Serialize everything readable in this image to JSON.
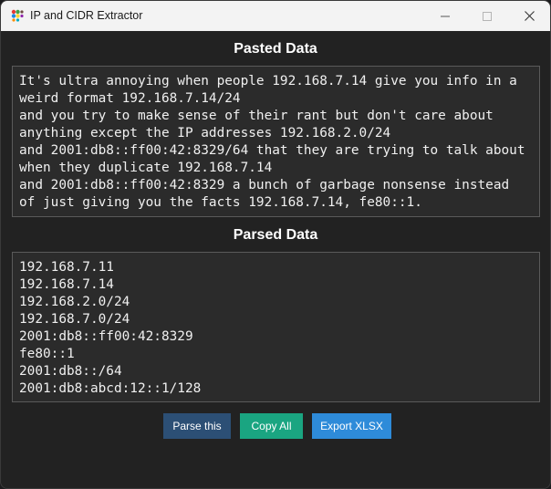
{
  "window": {
    "title": "IP and CIDR Extractor"
  },
  "pasted": {
    "title": "Pasted Data",
    "text": "It's ultra annoying when people 192.168.7.14 give you info in a weird format 192.168.7.14/24\nand you try to make sense of their rant but don't care about anything except the IP addresses 192.168.2.0/24\nand 2001:db8::ff00:42:8329/64 that they are trying to talk about when they duplicate 192.168.7.14\nand 2001:db8::ff00:42:8329 a bunch of garbage nonsense instead of just giving you the facts 192.168.7.14, fe80::1."
  },
  "parsed": {
    "title": "Parsed Data",
    "items": [
      "192.168.7.11",
      "192.168.7.14",
      "192.168.2.0/24",
      "192.168.7.0/24",
      "2001:db8::ff00:42:8329",
      "fe80::1",
      "2001:db8::/64",
      "2001:db8:abcd:12::1/128"
    ]
  },
  "buttons": {
    "parse": "Parse this",
    "copy": "Copy All",
    "export": "Export XLSX"
  },
  "colors": {
    "parse_button": "#2c4f75",
    "copy_button": "#1aa581",
    "export_button": "#2e8bd9",
    "background": "#222222",
    "textbox": "#2b2b2b"
  },
  "icons": {
    "app": "colored-dots-app-icon",
    "minimize": "minimize-icon",
    "maximize": "maximize-icon",
    "close": "close-icon"
  }
}
